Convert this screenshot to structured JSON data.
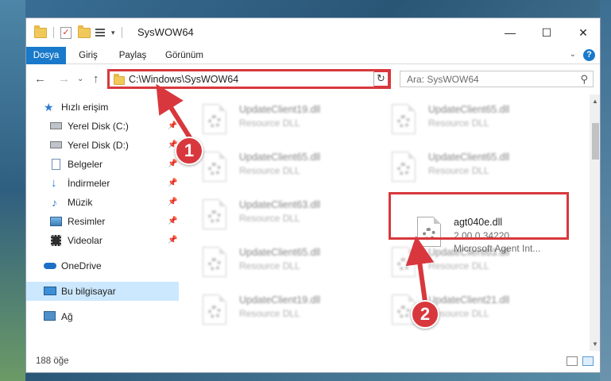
{
  "window": {
    "title": "SysWOW64",
    "controls": {
      "minimize": "—",
      "maximize": "☐",
      "close": "✕"
    }
  },
  "ribbon": {
    "tabs": [
      {
        "label": "Dosya",
        "active": true
      },
      {
        "label": "Giriş",
        "active": false
      },
      {
        "label": "Paylaş",
        "active": false
      },
      {
        "label": "Görünüm",
        "active": false
      }
    ],
    "help": "?"
  },
  "address": {
    "path": "C:\\Windows\\SysWOW64",
    "search_placeholder": "Ara: SysWOW64"
  },
  "sidebar": {
    "items": [
      {
        "label": "Hızlı erişim",
        "icon": "star-icon"
      },
      {
        "label": "Yerel Disk (C:)",
        "icon": "drive-icon",
        "pinned": true
      },
      {
        "label": "Yerel Disk (D:)",
        "icon": "drive-icon",
        "pinned": true
      },
      {
        "label": "Belgeler",
        "icon": "documents-icon",
        "pinned": true
      },
      {
        "label": "İndirmeler",
        "icon": "download-icon",
        "pinned": true
      },
      {
        "label": "Müzik",
        "icon": "music-icon",
        "pinned": true
      },
      {
        "label": "Resimler",
        "icon": "pictures-icon",
        "pinned": true
      },
      {
        "label": "Videolar",
        "icon": "videos-icon",
        "pinned": true
      },
      {
        "label": "OneDrive",
        "icon": "cloud-icon"
      },
      {
        "label": "Bu bilgisayar",
        "icon": "computer-icon",
        "selected": true
      },
      {
        "label": "Ağ",
        "icon": "network-icon"
      }
    ]
  },
  "files": [
    {
      "name": "UpdateClient19.dll",
      "type": "Resource DLL"
    },
    {
      "name": "UpdateClient65.dll",
      "type": "Resource DLL"
    },
    {
      "name": "UpdateClient65.dll",
      "type": "Resource DLL"
    },
    {
      "name": "UpdateClient65.dll",
      "type": "Resource DLL"
    },
    {
      "name": "UpdateClient63.dll",
      "type": "Resource DLL"
    },
    {
      "name": "agt040e.dll",
      "type": "2.00.0.34220",
      "desc": "Microsoft Agent Int..."
    },
    {
      "name": "UpdateClient65.dll",
      "type": "Resource DLL"
    },
    {
      "name": "UpdateClient63.dll",
      "type": "Resource DLL"
    },
    {
      "name": "UpdateClient19.dll",
      "type": "Resource DLL"
    },
    {
      "name": "UpdateClient21.dll",
      "type": "Resource DLL"
    }
  ],
  "status": {
    "count": "188 öğe"
  },
  "annotations": {
    "marker1": "1",
    "marker2": "2",
    "color": "#d8383d"
  }
}
